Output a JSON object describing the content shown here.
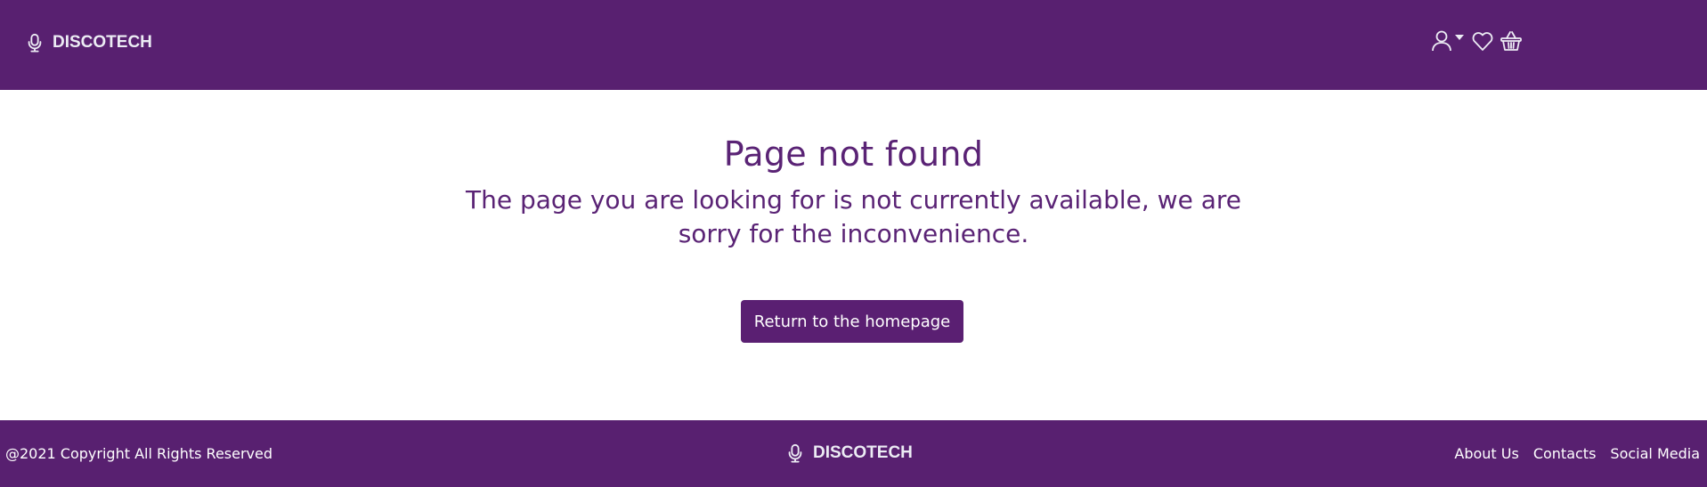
{
  "header": {
    "brand": "DISCOTECH",
    "icons": [
      "microphone-icon",
      "user-icon",
      "caret-down-icon",
      "heart-icon",
      "basket-icon"
    ]
  },
  "main": {
    "title": "Page not found",
    "message": "The page you are looking for is not currently available, we are sorry for the inconvenience.",
    "button_label": "Return to the homepage"
  },
  "footer": {
    "copyright": "@2021 Copyright All Rights Reserved",
    "brand": "DISCOTECH",
    "links": [
      "About Us",
      "Contacts",
      "Social Media"
    ]
  },
  "colors": {
    "brand_purple": "#582070",
    "text_purple": "#5a2375",
    "white": "#ffffff"
  }
}
